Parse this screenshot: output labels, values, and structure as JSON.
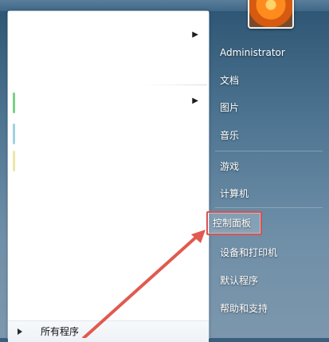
{
  "start_menu": {
    "all_programs_label": "所有程序",
    "right_items": [
      {
        "label": "Administrator"
      },
      {
        "label": "文档"
      },
      {
        "label": "图片"
      },
      {
        "label": "音乐"
      },
      {
        "label": "游戏"
      },
      {
        "label": "计算机"
      },
      {
        "label": "控制面板"
      },
      {
        "label": "设备和打印机"
      },
      {
        "label": "默认程序"
      },
      {
        "label": "帮助和支持"
      }
    ],
    "submenu_arrow": "▶"
  },
  "colors": {
    "highlight_border": "#d9534f",
    "annotation_arrow": "#e05a4e"
  },
  "icons": [
    "chevron-right-icon",
    "triangle-right-icon",
    "user-avatar-icon"
  ]
}
